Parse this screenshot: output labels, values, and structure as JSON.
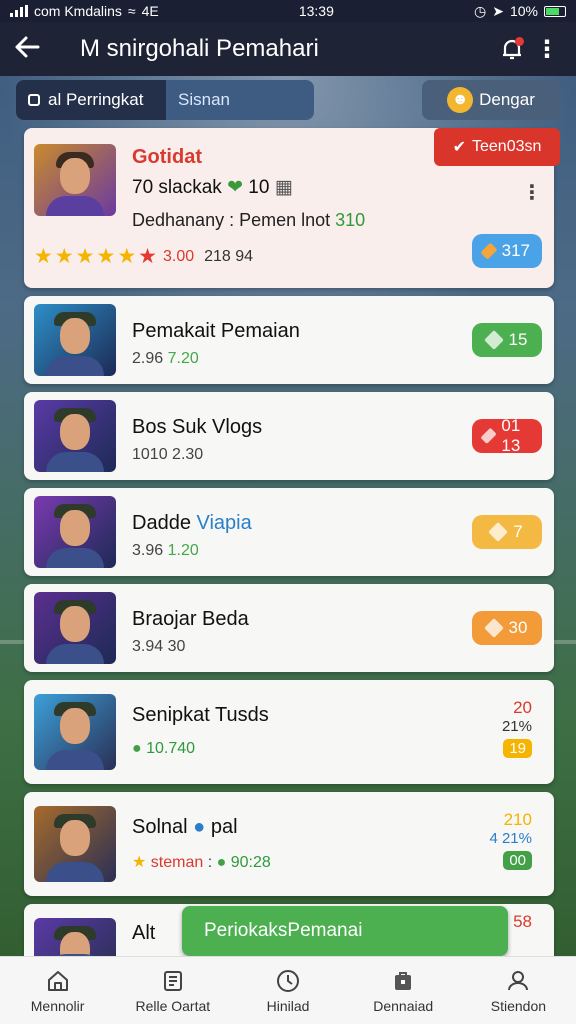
{
  "status_bar": {
    "carrier": "com Kmdalins",
    "network": "4E",
    "time": "13:39",
    "battery": "10%"
  },
  "app_bar": {
    "title": "M snirgohali Pemahari"
  },
  "tabs": {
    "ranking": "al Perringkat",
    "season": "Sisnan",
    "friends": "Dengar"
  },
  "top_card": {
    "badge": "Teen03sn",
    "name": "Gotidat",
    "line1": "70 slackak",
    "line1_count": "10",
    "line2_prefix": "Dedhanany : Pemen lnot",
    "line2_value": "310",
    "rating_value": "3.00",
    "rating_extra": "218 94",
    "pill_value": "317",
    "pill_color": "#49a3e6"
  },
  "players": [
    {
      "name": "Pemakait Pemaian",
      "stat_a": "2.96",
      "stat_b": "7.20",
      "pill": "15",
      "pill_color": "#4caf50",
      "avatar_bg": "#2d8fc7",
      "accent": "#46a84a"
    },
    {
      "name": "Bos Suk Vlogs",
      "stat_a": "1010",
      "stat_b": "2.30",
      "pill": "01 13",
      "pill_color": "#e53935",
      "avatar_bg": "#5a3aa6",
      "accent": "#444"
    },
    {
      "name": "Dadde",
      "name_extra": "Viapia",
      "stat_a": "3.96",
      "stat_b": "1.20",
      "pill": "7",
      "pill_color": "#f4b942",
      "avatar_bg": "#7a3ab0",
      "accent": "#46a84a"
    },
    {
      "name": "Braojar Beda",
      "stat_a": "3.94",
      "stat_b": "30",
      "pill": "30",
      "pill_color": "#f29b38",
      "avatar_bg": "#5b2f8f",
      "accent": "#444"
    }
  ],
  "players_side": [
    {
      "name": "Senipkat Tusds",
      "sub_value": "10.740",
      "side_top": "20",
      "side_mid": "21%",
      "side_badge": "19",
      "side_badge_color": "#f4b400",
      "avatar_bg": "#3ca0d8"
    },
    {
      "name": "Solnal",
      "name_extra": "pal",
      "sub_label": "steman",
      "sub_value": "90:28",
      "side_top": "210",
      "side_mid": "4 21%",
      "side_badge": "00",
      "side_badge_color": "#43a047",
      "avatar_bg": "#a66b2b"
    },
    {
      "name": "Alt",
      "side_top": "58"
    }
  ],
  "float_button": "PeriokaksPemanai",
  "bottom_nav": [
    {
      "label": "Mennolir",
      "icon": "home-icon"
    },
    {
      "label": "Relle Oartat",
      "icon": "list-icon"
    },
    {
      "label": "Hinilad",
      "icon": "clock-icon"
    },
    {
      "label": "Dennaiad",
      "icon": "bag-icon"
    },
    {
      "label": "Stiendon",
      "icon": "person-icon"
    }
  ]
}
